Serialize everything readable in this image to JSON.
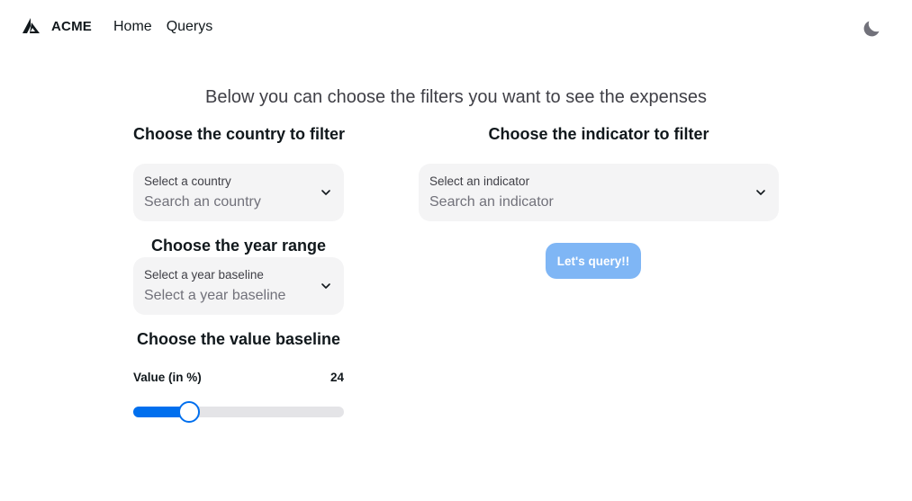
{
  "navbar": {
    "brand_name": "ACME",
    "links": [
      {
        "label": "Home"
      },
      {
        "label": "Querys"
      }
    ],
    "logo_icon": "acme-triangle-icon",
    "theme_toggle_icon": "moon-icon"
  },
  "intro_text": "Below you can choose the filters you want to see the expenses",
  "country_filter": {
    "heading": "Choose the country to filter",
    "label": "Select a country",
    "placeholder": "Search an country"
  },
  "year_filter": {
    "heading": "Choose the year range",
    "label": "Select a year baseline",
    "placeholder": "Select a year baseline"
  },
  "value_filter": {
    "heading": "Choose the value baseline",
    "slider_label": "Value (in %)",
    "value": "24",
    "min": 0,
    "max": 90
  },
  "indicator_filter": {
    "heading": "Choose the indicator to filter",
    "label": "Select an indicator",
    "placeholder": "Search an indicator"
  },
  "query_button": {
    "label": "Let's query!!"
  },
  "colors": {
    "accent": "#006fee",
    "button_disabled": "#7fb6f5",
    "input_bg": "#f4f4f5"
  }
}
